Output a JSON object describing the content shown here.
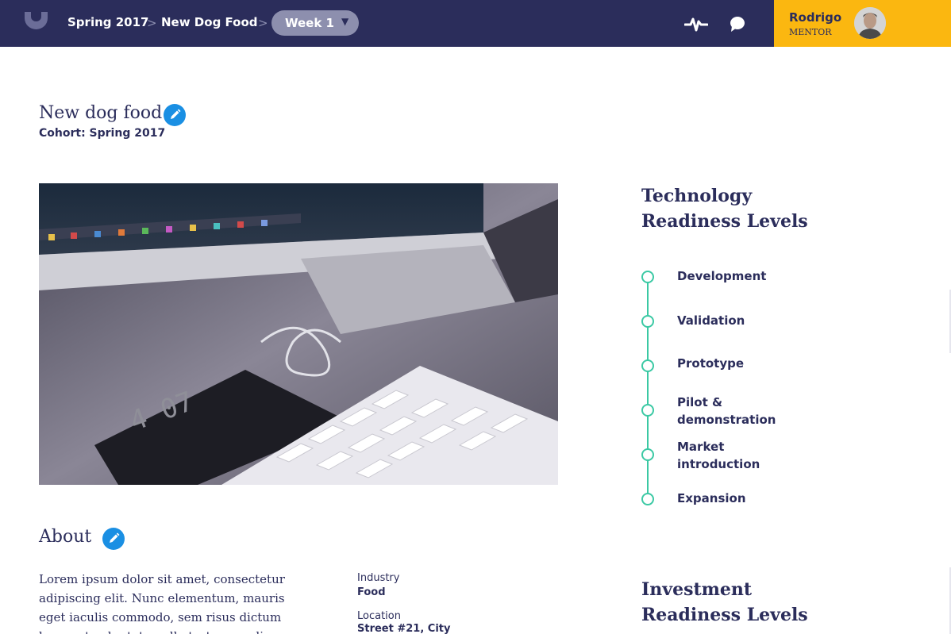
{
  "topbar": {
    "logo_icon": "logo-u-icon",
    "breadcrumb": [
      "Spring 2017",
      "New Dog Food"
    ],
    "separator": ">",
    "week_select": {
      "value": "Week 1",
      "caret": "▼"
    },
    "activity_icon": "pulse-icon",
    "chat_icon": "chat-bubble-icon",
    "user": {
      "name": "Rodrigo",
      "role": "MENTOR"
    },
    "colors": {
      "bar": "#2b2d5b",
      "user_panel": "#fbb710",
      "select": "#8d8fae"
    }
  },
  "project": {
    "title": "New dog food",
    "cohort": "Cohort: Spring 2017",
    "edit_icon": "pencil-icon"
  },
  "about": {
    "title": "About",
    "text": "Lorem ipsum dolor sit amet, consectetur adipiscing elit. Nunc elementum, mauris eget iaculis commodo, sem risus dictum lacus, at vulputate nulla tortor ac odio. Aliquam sed libero.",
    "fields": [
      {
        "label": "Industry",
        "value": "Food"
      },
      {
        "label": "Location",
        "value": "Street #21, City"
      }
    ]
  },
  "trl": {
    "title": "Technology Readiness Levels",
    "levels": [
      "Development",
      "Validation",
      "Prototype",
      "Pilot & demonstration",
      "Market introduction",
      "Expansion"
    ],
    "accent": "#3bc9a4"
  },
  "irl": {
    "title": "Investment Readiness Levels"
  }
}
